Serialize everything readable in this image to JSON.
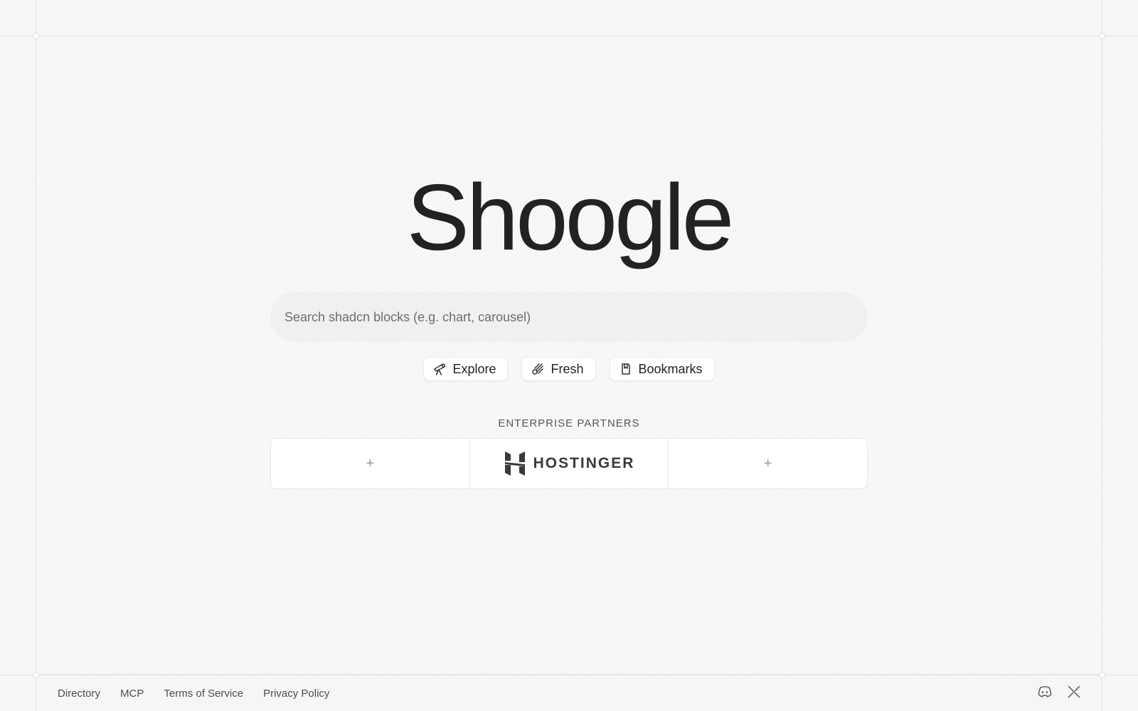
{
  "brand": {
    "logo_text": "Shoogle"
  },
  "search": {
    "placeholder": "Search shadcn blocks (e.g. chart, carousel)",
    "value": ""
  },
  "quick_links": [
    {
      "label": "Explore",
      "icon": "telescope-icon"
    },
    {
      "label": "Fresh",
      "icon": "comet-icon"
    },
    {
      "label": "Bookmarks",
      "icon": "bookmark-icon"
    }
  ],
  "partners": {
    "heading": "ENTERPRISE PARTNERS",
    "slots": [
      {
        "type": "empty",
        "label": "+"
      },
      {
        "type": "logo",
        "label": "HOSTINGER"
      },
      {
        "type": "empty",
        "label": "+"
      }
    ]
  },
  "footer": {
    "links": [
      "Directory",
      "MCP",
      "Terms of Service",
      "Privacy Policy"
    ],
    "social": [
      {
        "name": "discord",
        "icon": "discord-icon"
      },
      {
        "name": "x",
        "icon": "x-icon"
      }
    ]
  },
  "colors": {
    "background": "#f6f6f6",
    "text": "#222222",
    "search_bg": "#f0f0f0",
    "card_bg": "#ffffff",
    "border": "#e6e6e6"
  }
}
